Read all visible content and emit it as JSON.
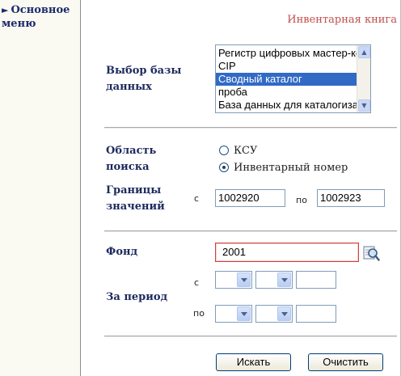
{
  "sidebar": {
    "menu_arrow": "►",
    "menu_label": "Основное меню"
  },
  "page": {
    "title": "Инвентарная книга"
  },
  "database": {
    "label": "Выбор базы данных",
    "options": [
      "Регистр цифровых мастер-копий",
      "CIP",
      "Сводный каталог",
      "проба",
      "База данных для каталогизации"
    ],
    "selected": "Сводный каталог"
  },
  "search_area": {
    "label": "Область поиска",
    "options": [
      {
        "label": "КСУ",
        "checked": false
      },
      {
        "label": "Инвентарный номер",
        "checked": true
      }
    ]
  },
  "range": {
    "label": "Границы значений",
    "from_label": "с",
    "from_value": "1002920",
    "to_label": "по",
    "to_value": "1002923"
  },
  "fond": {
    "label": "Фонд",
    "value": "2001",
    "lookup_icon": "search-lookup-icon"
  },
  "period": {
    "label": "За период",
    "from_label": "с",
    "to_label": "по"
  },
  "buttons": {
    "search": "Искать",
    "clear": "Очистить"
  }
}
